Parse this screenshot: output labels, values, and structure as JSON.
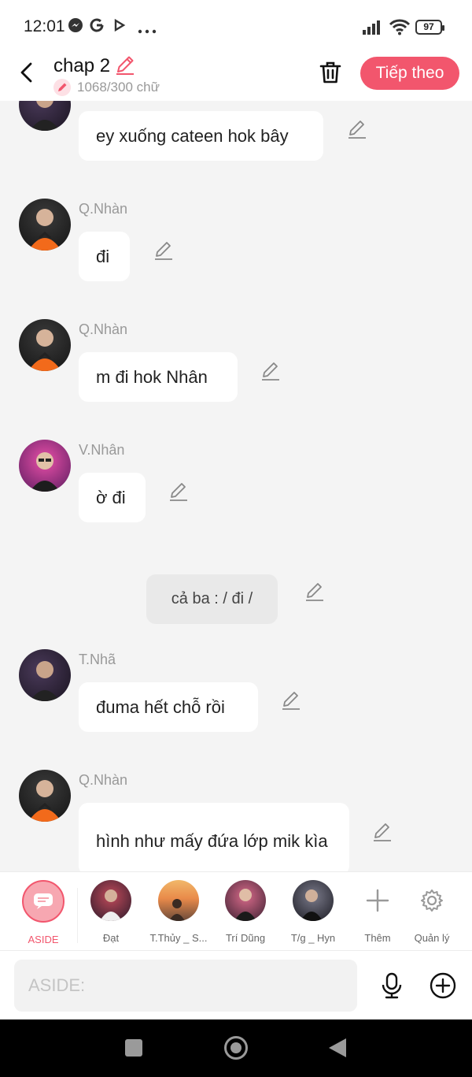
{
  "status_bar": {
    "time": "12:01",
    "battery": "97"
  },
  "header": {
    "title": "chap 2",
    "word_count": "1068/300 chữ",
    "next_label": "Tiếp theo"
  },
  "messages": [
    {
      "sender": "",
      "text": "ey xuống cateen hok bây",
      "avatar": "avatar-tnha"
    },
    {
      "sender": "Q.Nhàn",
      "text": "đi",
      "avatar": "avatar-qnhan"
    },
    {
      "sender": "Q.Nhàn",
      "text": "m đi hok Nhân",
      "avatar": "avatar-qnhan"
    },
    {
      "sender": "V.Nhân",
      "text": "ờ đi",
      "avatar": "avatar-vnhan"
    },
    {
      "sender": "",
      "text": "cả ba : / đi /",
      "avatar": ""
    },
    {
      "sender": "T.Nhã",
      "text": "đuma hết chỗ rồi",
      "avatar": "avatar-tnha"
    },
    {
      "sender": "Q.Nhàn",
      "text": "hình như mấy đứa lớp mik kìa",
      "avatar": "avatar-qnhan"
    }
  ],
  "characters": [
    {
      "label": "ASIDE"
    },
    {
      "label": "Đạt"
    },
    {
      "label": "T.Thủy _ S..."
    },
    {
      "label": "Trí Dũng"
    },
    {
      "label": "T/g _ Hyn"
    },
    {
      "label": "Thêm"
    },
    {
      "label": "Quản lý"
    }
  ],
  "input": {
    "placeholder": "ASIDE:"
  },
  "colors": {
    "accent": "#f2566d",
    "background": "#f4f4f4"
  }
}
